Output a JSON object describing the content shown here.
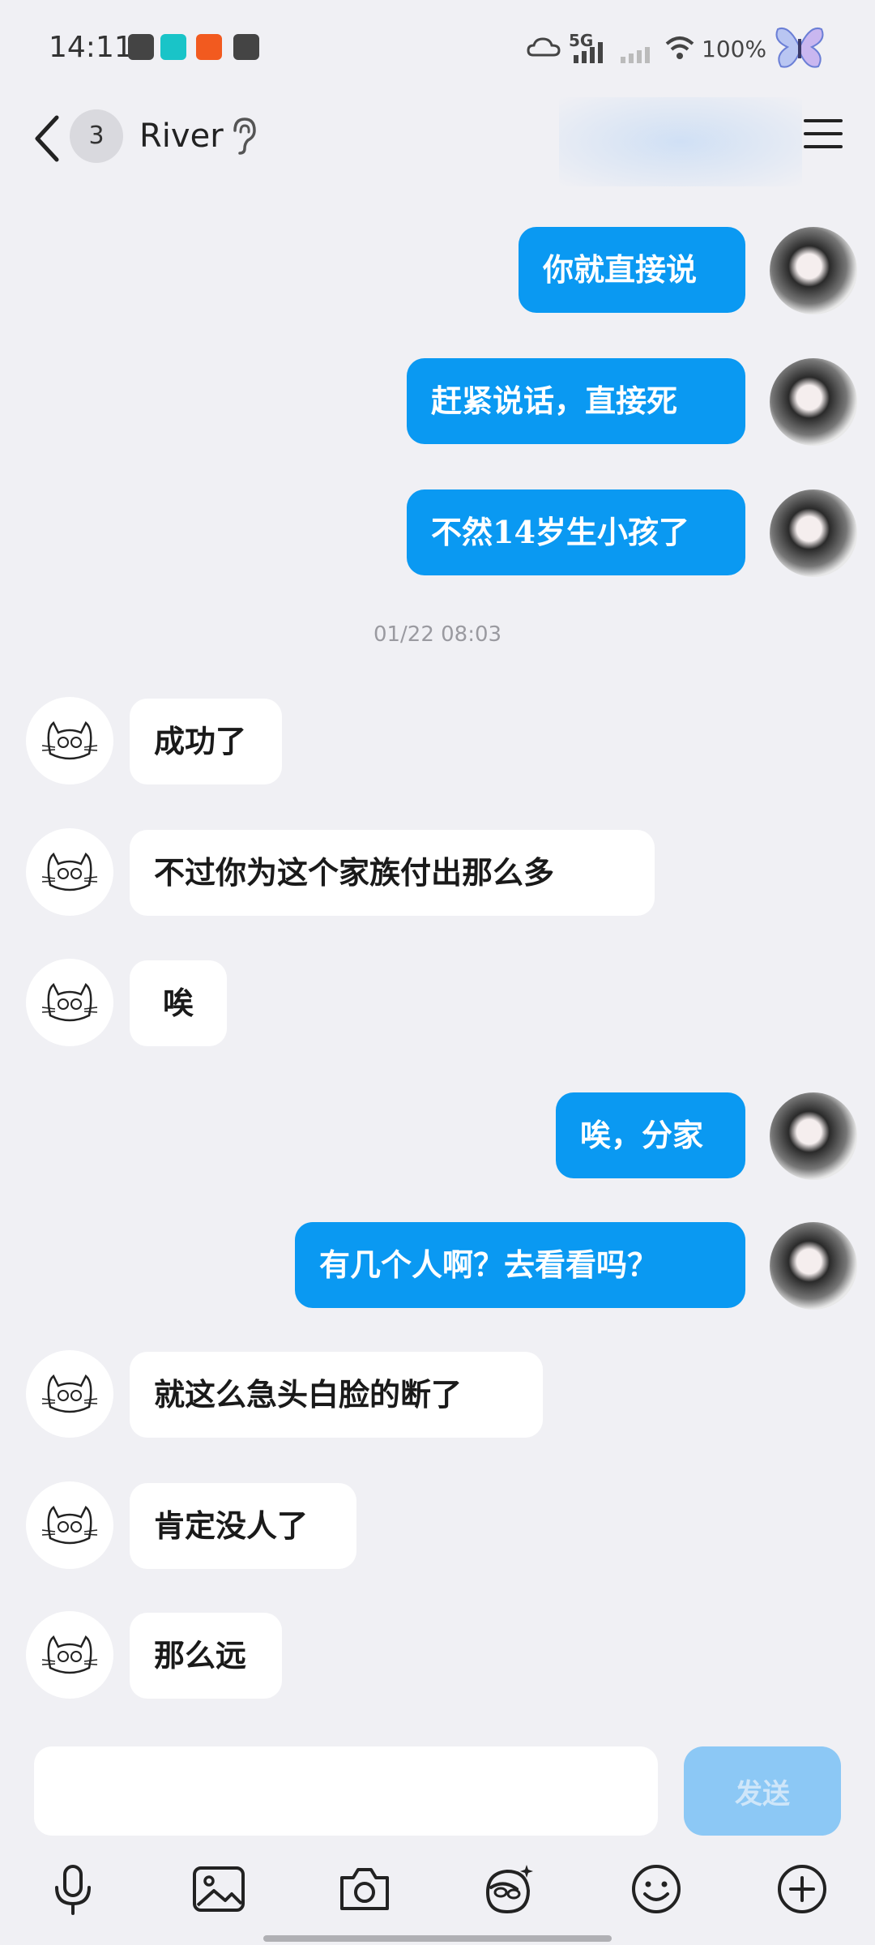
{
  "status_bar": {
    "time": "14:11",
    "network": "5G",
    "battery": "100%"
  },
  "header": {
    "unread_count": "3",
    "contact_name": "River"
  },
  "conversation": {
    "messages_before": [
      {
        "text": "你就直接说"
      },
      {
        "text": "赶紧说话，直接死"
      },
      {
        "text": "不然14岁生小孩了"
      }
    ],
    "timestamp": "01/22 08:03",
    "messages_after": [
      {
        "text": "成功了"
      },
      {
        "text": "不过你为这个家族付出那么多"
      },
      {
        "text": "唉"
      },
      {
        "text": "唉，分家"
      },
      {
        "text": "有几个人啊？去看看吗？"
      },
      {
        "text": "就这么急头白脸的断了"
      },
      {
        "text": "肯定没人了"
      },
      {
        "text": "那么远"
      }
    ]
  },
  "input": {
    "value": "",
    "send_label": "发送"
  },
  "colors": {
    "outgoing_bubble": "#0a99f2",
    "incoming_bubble": "#ffffff",
    "send_button_disabled": "#8cc8f5"
  },
  "toolbar_icons": [
    "microphone-icon",
    "image-icon",
    "camera-icon",
    "face-sticker-icon",
    "emoji-icon",
    "plus-icon"
  ]
}
